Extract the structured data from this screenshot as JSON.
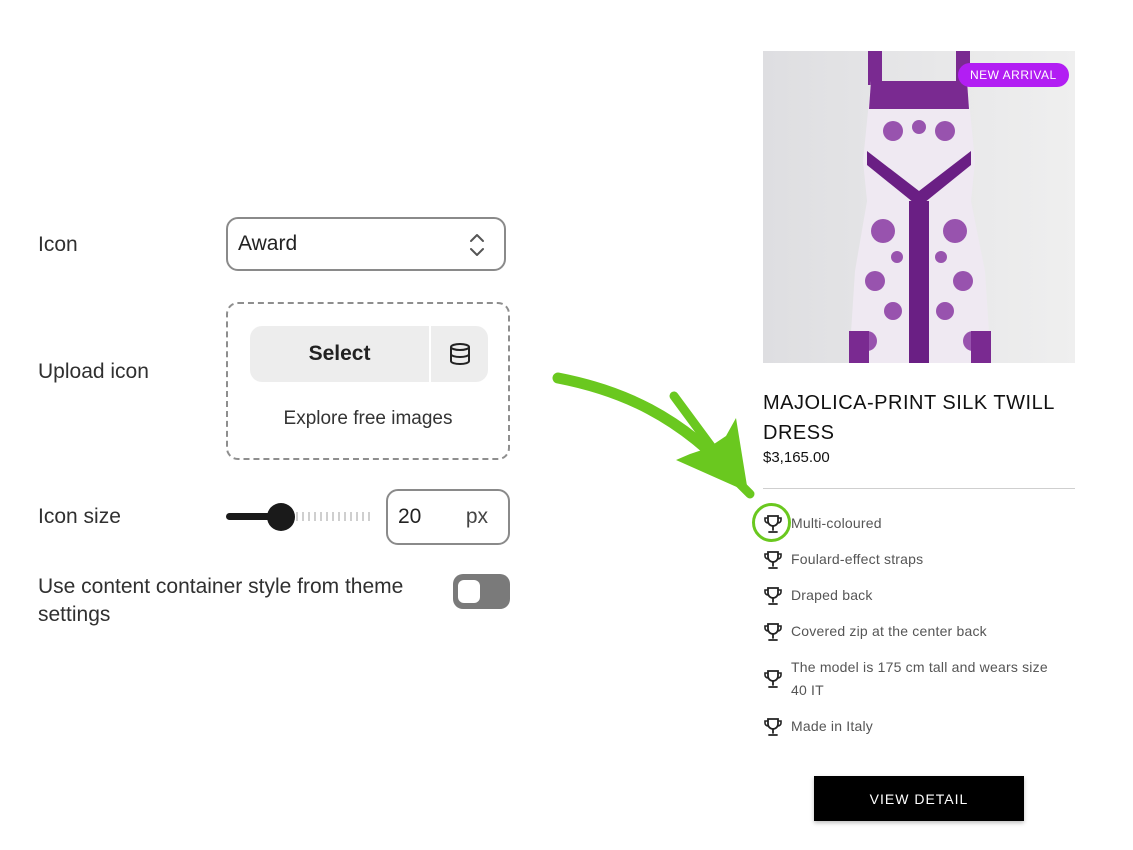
{
  "settings": {
    "icon_label": "Icon",
    "icon_value": "Award",
    "upload_label": "Upload icon",
    "select_button": "Select",
    "explore_link": "Explore free images",
    "size_label": "Icon size",
    "size_value": "20",
    "size_unit": "px",
    "size_slider_fraction": 0.35,
    "container_label": "Use content container style from theme settings",
    "container_toggle_on": false
  },
  "product": {
    "badge": "NEW ARRIVAL",
    "title": "MAJOLICA-PRINT SILK TWILL DRESS",
    "price": "$3,165.00",
    "features": [
      "Multi-coloured",
      "Foulard-effect straps",
      "Draped back",
      "Covered zip at the center back",
      "The model is 175 cm tall and wears size 40 IT",
      "Made in Italy"
    ],
    "feature_icon": "trophy-icon",
    "view_button": "VIEW DETAIL"
  },
  "colors": {
    "badge_bg": "#b21ef3",
    "highlight": "#6ac81f",
    "button_bg": "#000000",
    "dress_purple": "#7a2a91"
  }
}
